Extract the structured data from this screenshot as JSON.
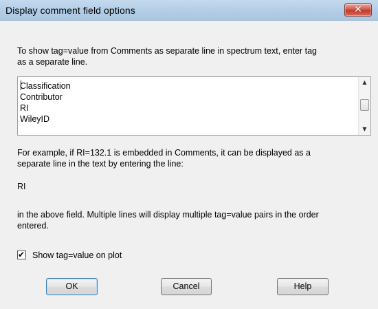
{
  "window": {
    "title": "Display comment field options"
  },
  "instructions": "To show tag=value from Comments as separate line in spectrum text, enter tag as a separate line.",
  "instructions_line1": "To show tag=value from Comments as separate line in spectrum text, enter tag",
  "instructions_line2": "as a separate line.",
  "tag_list": {
    "items": [
      "Classification",
      "Contributor",
      "RI",
      "WileyID"
    ]
  },
  "example": {
    "line1": "For example, if RI=132.1 is embedded in Comments, it can be displayed as a",
    "line2": "separate line in the text by entering the line:",
    "sample_tag": "RI",
    "line3": "in the above field. Multiple lines will display multiple tag=value pairs in the order",
    "line4": "entered."
  },
  "show_on_plot": {
    "label": "Show tag=value on plot",
    "checked": true
  },
  "buttons": {
    "ok": "OK",
    "cancel": "Cancel",
    "help": "Help"
  }
}
